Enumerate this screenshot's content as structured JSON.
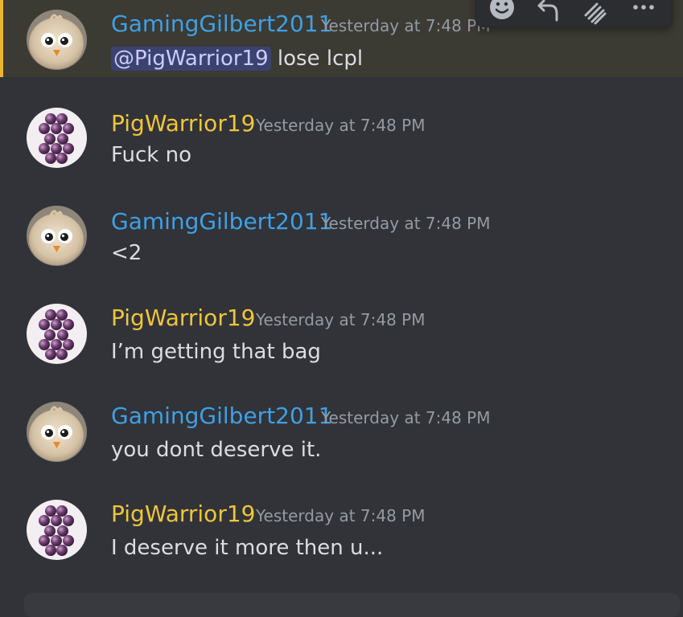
{
  "colors": {
    "background": "#313338",
    "highlight_background": "#3b3a33",
    "highlight_bar": "#f0b232",
    "blue_user": "#3fa0e5",
    "gold_user": "#f0c53c",
    "timestamp": "#949ba4",
    "text": "#dbdee1",
    "mention_bg": "#3c4270",
    "mention_text": "#c9cdfb"
  },
  "toolbar": {
    "icons": [
      "add-reaction-icon",
      "reply-icon",
      "forward-icon",
      "more-icon"
    ]
  },
  "messages": [
    {
      "author": "GamingGilbert2011",
      "timestamp": "Yesterday at 7:48 PM",
      "mention": "@PigWarrior19",
      "text": " lose lcpl",
      "avatar": "angry-birds-chick-avatar"
    },
    {
      "author": "PigWarrior19",
      "timestamp": "Yesterday at 7:48 PM",
      "text": "Fuck no",
      "avatar": "purple-grapes-avatar"
    },
    {
      "author": "GamingGilbert2011",
      "timestamp": "Yesterday at 7:48 PM",
      "text": "<2",
      "avatar": "angry-birds-chick-avatar"
    },
    {
      "author": "PigWarrior19",
      "timestamp": "Yesterday at 7:48 PM",
      "text": "I’m getting that bag",
      "avatar": "purple-grapes-avatar"
    },
    {
      "author": "GamingGilbert2011",
      "timestamp": "Yesterday at 7:48 PM",
      "text": "you dont deserve it.",
      "avatar": "angry-birds-chick-avatar"
    },
    {
      "author": "PigWarrior19",
      "timestamp": "Yesterday at 7:48 PM",
      "text": "I deserve it more then u...",
      "avatar": "purple-grapes-avatar"
    }
  ]
}
